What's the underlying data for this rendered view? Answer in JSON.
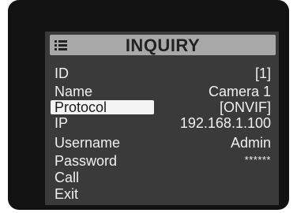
{
  "window": {
    "title": "INQUIRY",
    "title_icon": "list-icon"
  },
  "menu": [
    {
      "key": "id",
      "label": "ID",
      "value": "[1]"
    },
    {
      "key": "name",
      "label": "Name",
      "value": "Camera 1"
    },
    {
      "key": "protocol",
      "label": "Protocol",
      "value": "[ONVIF]",
      "selected": true
    },
    {
      "key": "ip",
      "label": "IP",
      "value": "192.168.1.100"
    },
    {
      "key": "username",
      "label": "Username",
      "value": "Admin"
    },
    {
      "key": "password",
      "label": "Password",
      "value": "******"
    },
    {
      "key": "call",
      "label": "Call"
    },
    {
      "key": "exit",
      "label": "Exit"
    }
  ],
  "colors": {
    "osd_background": "#3a3a3a",
    "header_background": "#a8a8a8",
    "selection_highlight": "#f4f4f4",
    "text": "#f0f0f0"
  }
}
